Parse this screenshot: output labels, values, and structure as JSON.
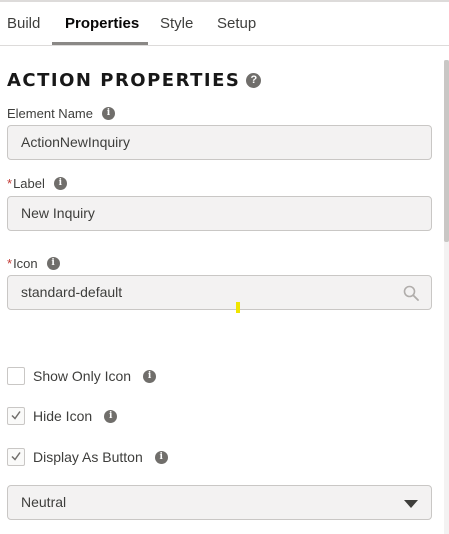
{
  "tabs": [
    {
      "label": "Build"
    },
    {
      "label": "Properties"
    },
    {
      "label": "Style"
    },
    {
      "label": "Setup"
    }
  ],
  "active_tab": "Properties",
  "section": {
    "title": "ACTION PROPERTIES",
    "help_glyph": "?"
  },
  "fields": {
    "element_name": {
      "label": "Element Name",
      "value": "ActionNewInquiry",
      "required": false
    },
    "label": {
      "label": "Label",
      "value": "New Inquiry",
      "required": true
    },
    "icon": {
      "label": "Icon",
      "value": "standard-default",
      "required": true
    }
  },
  "required_marker": "*",
  "info_glyph": "i",
  "checkboxes": [
    {
      "label": "Show Only Icon",
      "checked": false,
      "has_info": true
    },
    {
      "label": "Hide Icon",
      "checked": true,
      "has_info": true
    },
    {
      "label": "Display As Button",
      "checked": true,
      "has_info": true
    }
  ],
  "variant_select": {
    "selected": "Neutral"
  },
  "colors": {
    "required": "#c23934",
    "tab_underline": "#8a8886",
    "field_bg": "#f3f2f2",
    "cursor_highlight": "#f0e500"
  }
}
